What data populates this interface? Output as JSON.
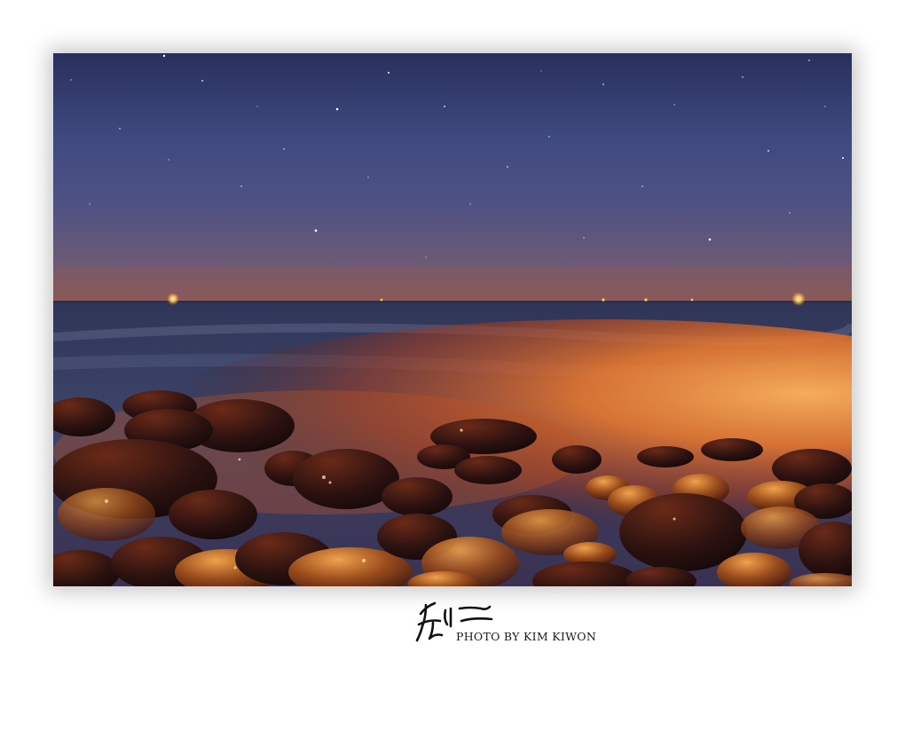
{
  "photo": {
    "subject": "night-seascape-pebble-beach",
    "colors": {
      "sky_top": "#2c3463",
      "sky_mid": "#4a5387",
      "horizon_glow": "#8a5a5a",
      "sea": "#3b4266",
      "orange_glow": "#f2893a",
      "rock_dark": "#1f0f10",
      "rock_lit": "#c9792e"
    }
  },
  "credit": {
    "signature_text": "운이",
    "signature_icon": "handwritten-signature-icon",
    "byline": "PHOTO BY KIM KIWON"
  }
}
